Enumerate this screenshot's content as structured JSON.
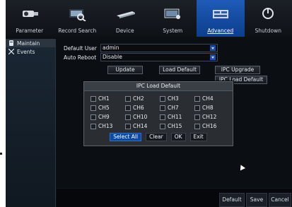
{
  "topnav": {
    "items": [
      {
        "label": "Parameter",
        "icon": "camera-icon"
      },
      {
        "label": "Record Search",
        "icon": "record-search-icon"
      },
      {
        "label": "Device",
        "icon": "device-icon"
      },
      {
        "label": "System",
        "icon": "system-icon"
      },
      {
        "label": "Advanced",
        "icon": "advanced-icon"
      },
      {
        "label": "Shutdown",
        "icon": "shutdown-icon"
      }
    ],
    "active": "Advanced",
    "active_color": "#1e5bb8"
  },
  "sidebar": {
    "items": [
      {
        "label": "Maintain",
        "icon": "maintain-icon"
      },
      {
        "label": "Events",
        "icon": "events-icon"
      }
    ],
    "active": "Maintain"
  },
  "main": {
    "default_user_label": "Default User",
    "default_user_value": "admin",
    "auto_reboot_label": "Auto Reboot",
    "auto_reboot_value": "Disable",
    "buttons": {
      "update": "Update",
      "load_default": "Load Default",
      "ipc_upgrade": "IPC Upgrade",
      "ipc_load_default": "IPC Load Default"
    }
  },
  "dialog": {
    "title": "IPC Load Default",
    "channels": [
      "CH1",
      "CH2",
      "CH3",
      "CH4",
      "CH5",
      "CH6",
      "CH7",
      "CH8",
      "CH9",
      "CH10",
      "CH11",
      "CH12",
      "CH13",
      "CH14",
      "CH15",
      "CH16"
    ],
    "buttons": {
      "select_all": "Select All",
      "clear": "Clear",
      "ok": "OK",
      "exit": "Exit"
    }
  },
  "bottombar": {
    "default": "Default",
    "save": "Save",
    "cancel": "Cancel"
  }
}
